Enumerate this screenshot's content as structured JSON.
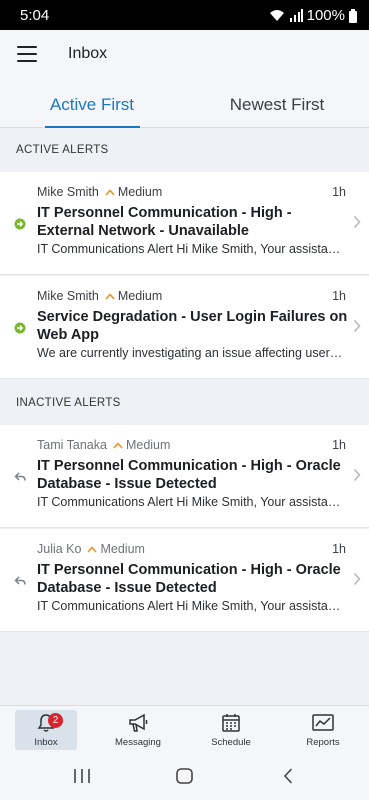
{
  "status_bar": {
    "time": "5:04",
    "battery": "100%"
  },
  "app_bar": {
    "title": "Inbox",
    "menu_icon": "hamburger-menu-icon"
  },
  "tabs": [
    {
      "label": "Active First",
      "selected": true
    },
    {
      "label": "Newest First",
      "selected": false
    }
  ],
  "sections": {
    "active": {
      "header": "ACTIVE ALERTS",
      "alerts": [
        {
          "sender": "Mike Smith",
          "priority": "Medium",
          "time": "1h",
          "subject": "IT Personnel Communication - High - External Network - Unavailable",
          "preview": "IT Communications Alert Hi Mike Smith, Your assistance is needed",
          "status_icon": "arrow-right-circle-icon"
        },
        {
          "sender": "Mike Smith",
          "priority": "Medium",
          "time": "1h",
          "subject": "Service Degradation - User Login Failures on Web App",
          "preview": "We are currently investigating an issue affecting user logins",
          "status_icon": "arrow-right-circle-icon"
        }
      ]
    },
    "inactive": {
      "header": "INACTIVE ALERTS",
      "alerts": [
        {
          "sender": "Tami Tanaka",
          "priority": "Medium",
          "time": "1h",
          "subject": "IT Personnel Communication - High - Oracle Database - Issue Detected",
          "preview": "IT Communications Alert Hi Mike Smith, Your assistance is needed",
          "status_icon": "reply-icon"
        },
        {
          "sender": "Julia Ko",
          "priority": "Medium",
          "time": "1h",
          "subject": "IT Personnel Communication - High - Oracle Database - Issue Detected",
          "preview": "IT Communications Alert Hi Mike Smith, Your assistance is needed",
          "status_icon": "reply-icon"
        }
      ]
    }
  },
  "bottom_nav": {
    "inbox": {
      "label": "Inbox",
      "badge": "2",
      "icon": "bell-icon",
      "selected": true
    },
    "messaging": {
      "label": "Messaging",
      "icon": "megaphone-icon"
    },
    "schedule": {
      "label": "Schedule",
      "icon": "calendar-icon"
    },
    "reports": {
      "label": "Reports",
      "icon": "chart-icon"
    }
  },
  "colors": {
    "accent": "#1a78c2",
    "priority": "#e8952c",
    "active_status": "#7cb82f",
    "badge": "#d9232d"
  }
}
